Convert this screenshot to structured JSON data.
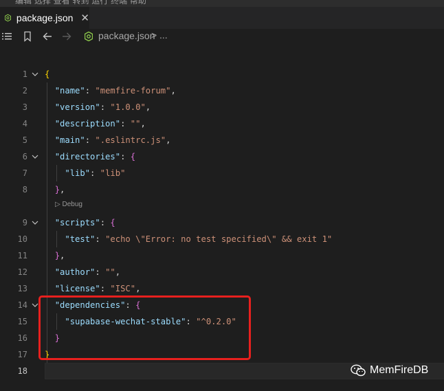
{
  "menu": {
    "cutoff_text": "编辑    选择    查看    转到    运行    终端    帮助"
  },
  "tab": {
    "label": "package.json",
    "close_glyph": "✕"
  },
  "breadcrumb": {
    "file": "package.json",
    "separator": ">",
    "more": "..."
  },
  "codelens": {
    "label": "Debug"
  },
  "editor": {
    "line_numbers": [
      "1",
      "2",
      "3",
      "4",
      "5",
      "6",
      "7",
      "8",
      "9",
      "10",
      "11",
      "12",
      "13",
      "14",
      "15",
      "16",
      "17",
      "18"
    ],
    "active_line": "18"
  },
  "colors": {
    "key": "#9cdcfe",
    "string": "#ce9178",
    "bracket_level1": "#ffd700",
    "bracket_level2": "#da70d6",
    "highlight_box": "#e8201e",
    "node_icon": "#8cc84b"
  },
  "watermark": {
    "text": "MemFireDB"
  },
  "icons": {
    "tab_file": "nodejs-icon",
    "breadcrumb_toggle": "list-icon",
    "bookmark": "bookmark-icon",
    "back": "arrow-left-icon",
    "forward": "arrow-right-icon",
    "watermark": "wechat-icon"
  }
}
